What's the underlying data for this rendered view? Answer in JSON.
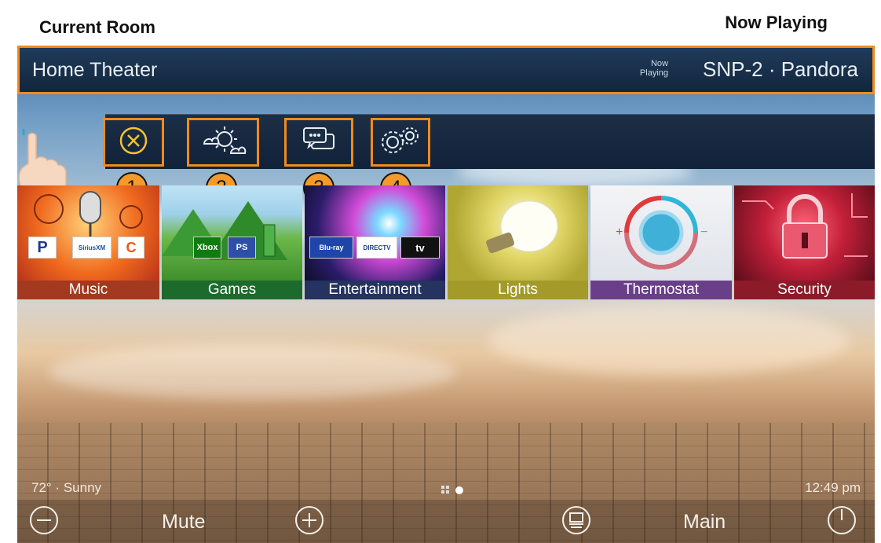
{
  "callouts": {
    "current_room": "Current Room",
    "now_playing": "Now Playing",
    "numbers": [
      "1",
      "2",
      "3",
      "4"
    ]
  },
  "header": {
    "room": "Home Theater",
    "now_playing_small": [
      "Now",
      "Playing"
    ],
    "track": "SNP-2 · Pandora"
  },
  "toolbar": {
    "icons": [
      "close-icon",
      "weather-icon",
      "messages-icon",
      "settings-icon"
    ]
  },
  "tiles": [
    {
      "label": "Music",
      "color": "#a3391e",
      "logos": [
        "P",
        "SiriusXM",
        "C"
      ]
    },
    {
      "label": "Games",
      "color": "#1c6b2c",
      "logos": [
        "Xbox",
        "PS"
      ]
    },
    {
      "label": "Entertainment",
      "color": "#24335f",
      "logos": [
        "Blu-ray",
        "DIRECTV",
        "tv"
      ]
    },
    {
      "label": "Lights",
      "color": "#a39a2a",
      "logos": []
    },
    {
      "label": "Thermostat",
      "color": "#6a3f8a",
      "logos": []
    },
    {
      "label": "Security",
      "color": "#8c1b2a",
      "logos": []
    }
  ],
  "status": {
    "weather": "72° · Sunny",
    "time": "12:49 pm"
  },
  "bottom": {
    "mute": "Mute",
    "main": "Main"
  },
  "colors": {
    "highlight": "#f08a1c",
    "badge": "#f39a2b"
  }
}
